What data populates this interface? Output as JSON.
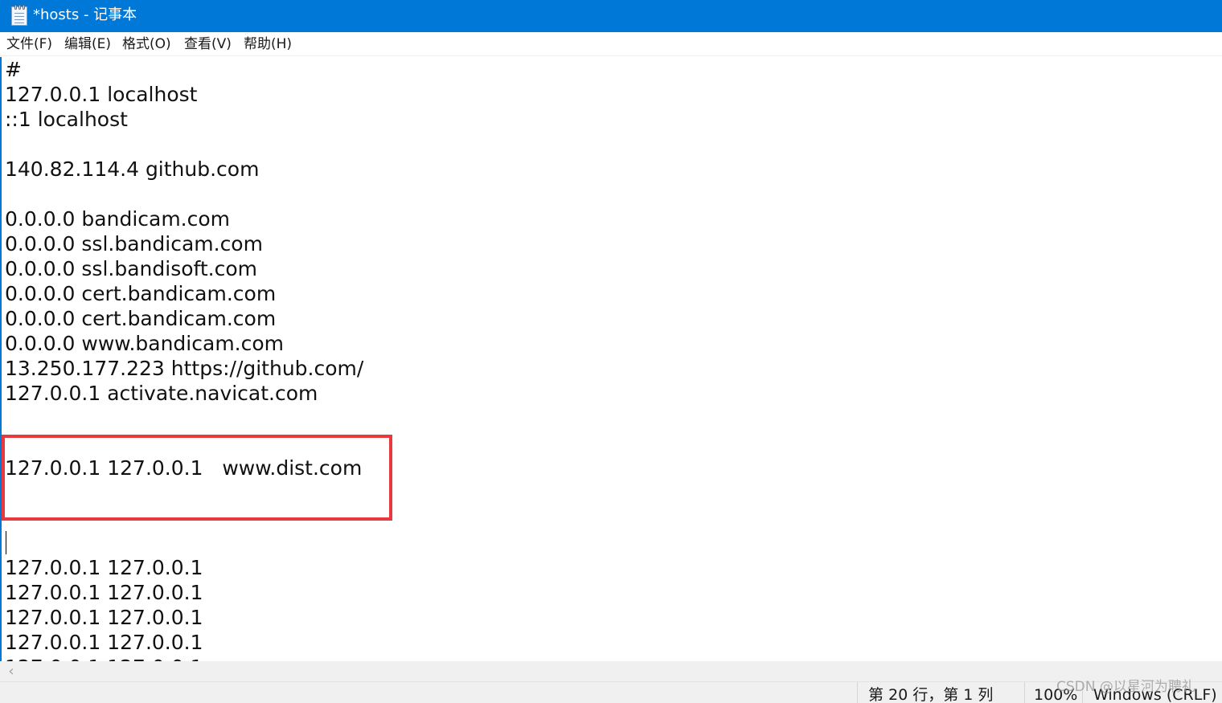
{
  "window": {
    "title": "*hosts - 记事本",
    "icon": "notepad-icon",
    "accent_color": "#0078d7"
  },
  "menu": {
    "items": [
      {
        "label": "文件(F)"
      },
      {
        "label": "编辑(E)"
      },
      {
        "label": "格式(O)"
      },
      {
        "label": "查看(V)"
      },
      {
        "label": "帮助(H)"
      }
    ]
  },
  "editor": {
    "lines": [
      "#",
      "127.0.0.1 localhost",
      "::1 localhost",
      "",
      "140.82.114.4 github.com",
      "",
      "0.0.0.0 bandicam.com",
      "0.0.0.0 ssl.bandicam.com",
      "0.0.0.0 ssl.bandisoft.com",
      "0.0.0.0 cert.bandicam.com",
      "0.0.0.0 cert.bandicam.com",
      "0.0.0.0 www.bandicam.com",
      "13.250.177.223 https://github.com/",
      "127.0.0.1 activate.navicat.com",
      "",
      "",
      "127.0.0.1 127.0.0.1   www.dist.com",
      "",
      "",
      "",
      "",
      "127.0.0.1 127.0.0.1",
      "127.0.0.1 127.0.0.1",
      "127.0.0.1 127.0.0.1",
      "127.0.0.1 127.0.0.1"
    ],
    "highlight_color": "#e8393f"
  },
  "scrollbar": {
    "left_arrow": "‹"
  },
  "status": {
    "position": "第 20 行，第 1 列",
    "zoom": "100%",
    "line_ending": "Windows (CRLF)"
  },
  "watermark": "CSDN @以星河为聘礼"
}
